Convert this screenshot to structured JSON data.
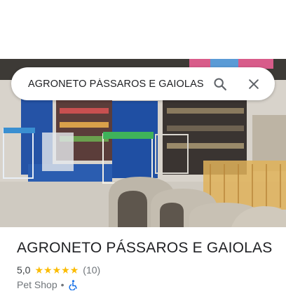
{
  "search": {
    "query": "AGRONETO PÁSSAROS E GAIOLAS"
  },
  "place": {
    "name": "AGRONETO PÁSSAROS E GAIOLAS",
    "rating": "5,0",
    "stars": 5,
    "review_count": "(10)",
    "category": "Pet Shop",
    "separator": "•",
    "accessibility_icon": "wheelchair-icon"
  },
  "icons": {
    "search": "search-icon",
    "close": "close-icon"
  },
  "colors": {
    "star": "#fbbc04",
    "accessibility": "#1a73e8",
    "title": "#202124",
    "secondary": "#70757a"
  }
}
